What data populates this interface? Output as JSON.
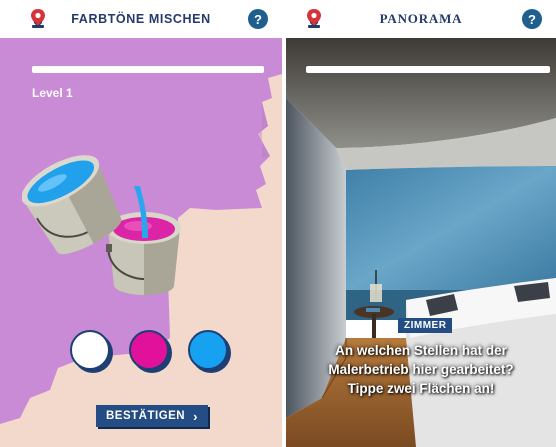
{
  "left_screen": {
    "header": {
      "title": "FARBTÖNE MISCHEN",
      "help_label": "?"
    },
    "level_label": "Level 1",
    "progress_fraction": 1.0,
    "swatches": [
      {
        "color": "#ffffff",
        "icon": "white-color-swatch"
      },
      {
        "color": "#e2119b",
        "icon": "magenta-color-swatch"
      },
      {
        "color": "#16a2f0",
        "icon": "blue-color-swatch"
      }
    ],
    "confirm_button": {
      "label": "BESTÄTIGEN",
      "icon": "chevron-right-icon"
    }
  },
  "right_screen": {
    "header": {
      "title": "PANORAMA",
      "help_label": "?"
    },
    "progress_fraction": 1.0,
    "room_label": "ZIMMER",
    "question_lines": [
      "An welchen Stellen hat der",
      "Malerbetrieb hier gearbeitet?",
      "Tippe zwei Flächen an!"
    ]
  },
  "colors": {
    "navy": "#233a6b",
    "help_blue": "#1f5f8e",
    "button_blue": "#234d84",
    "violet_paint": "#c98bd6",
    "peach": "#f3d9cb",
    "pin_red": "#d6343a",
    "wall_blue": "#4f8fb4"
  }
}
